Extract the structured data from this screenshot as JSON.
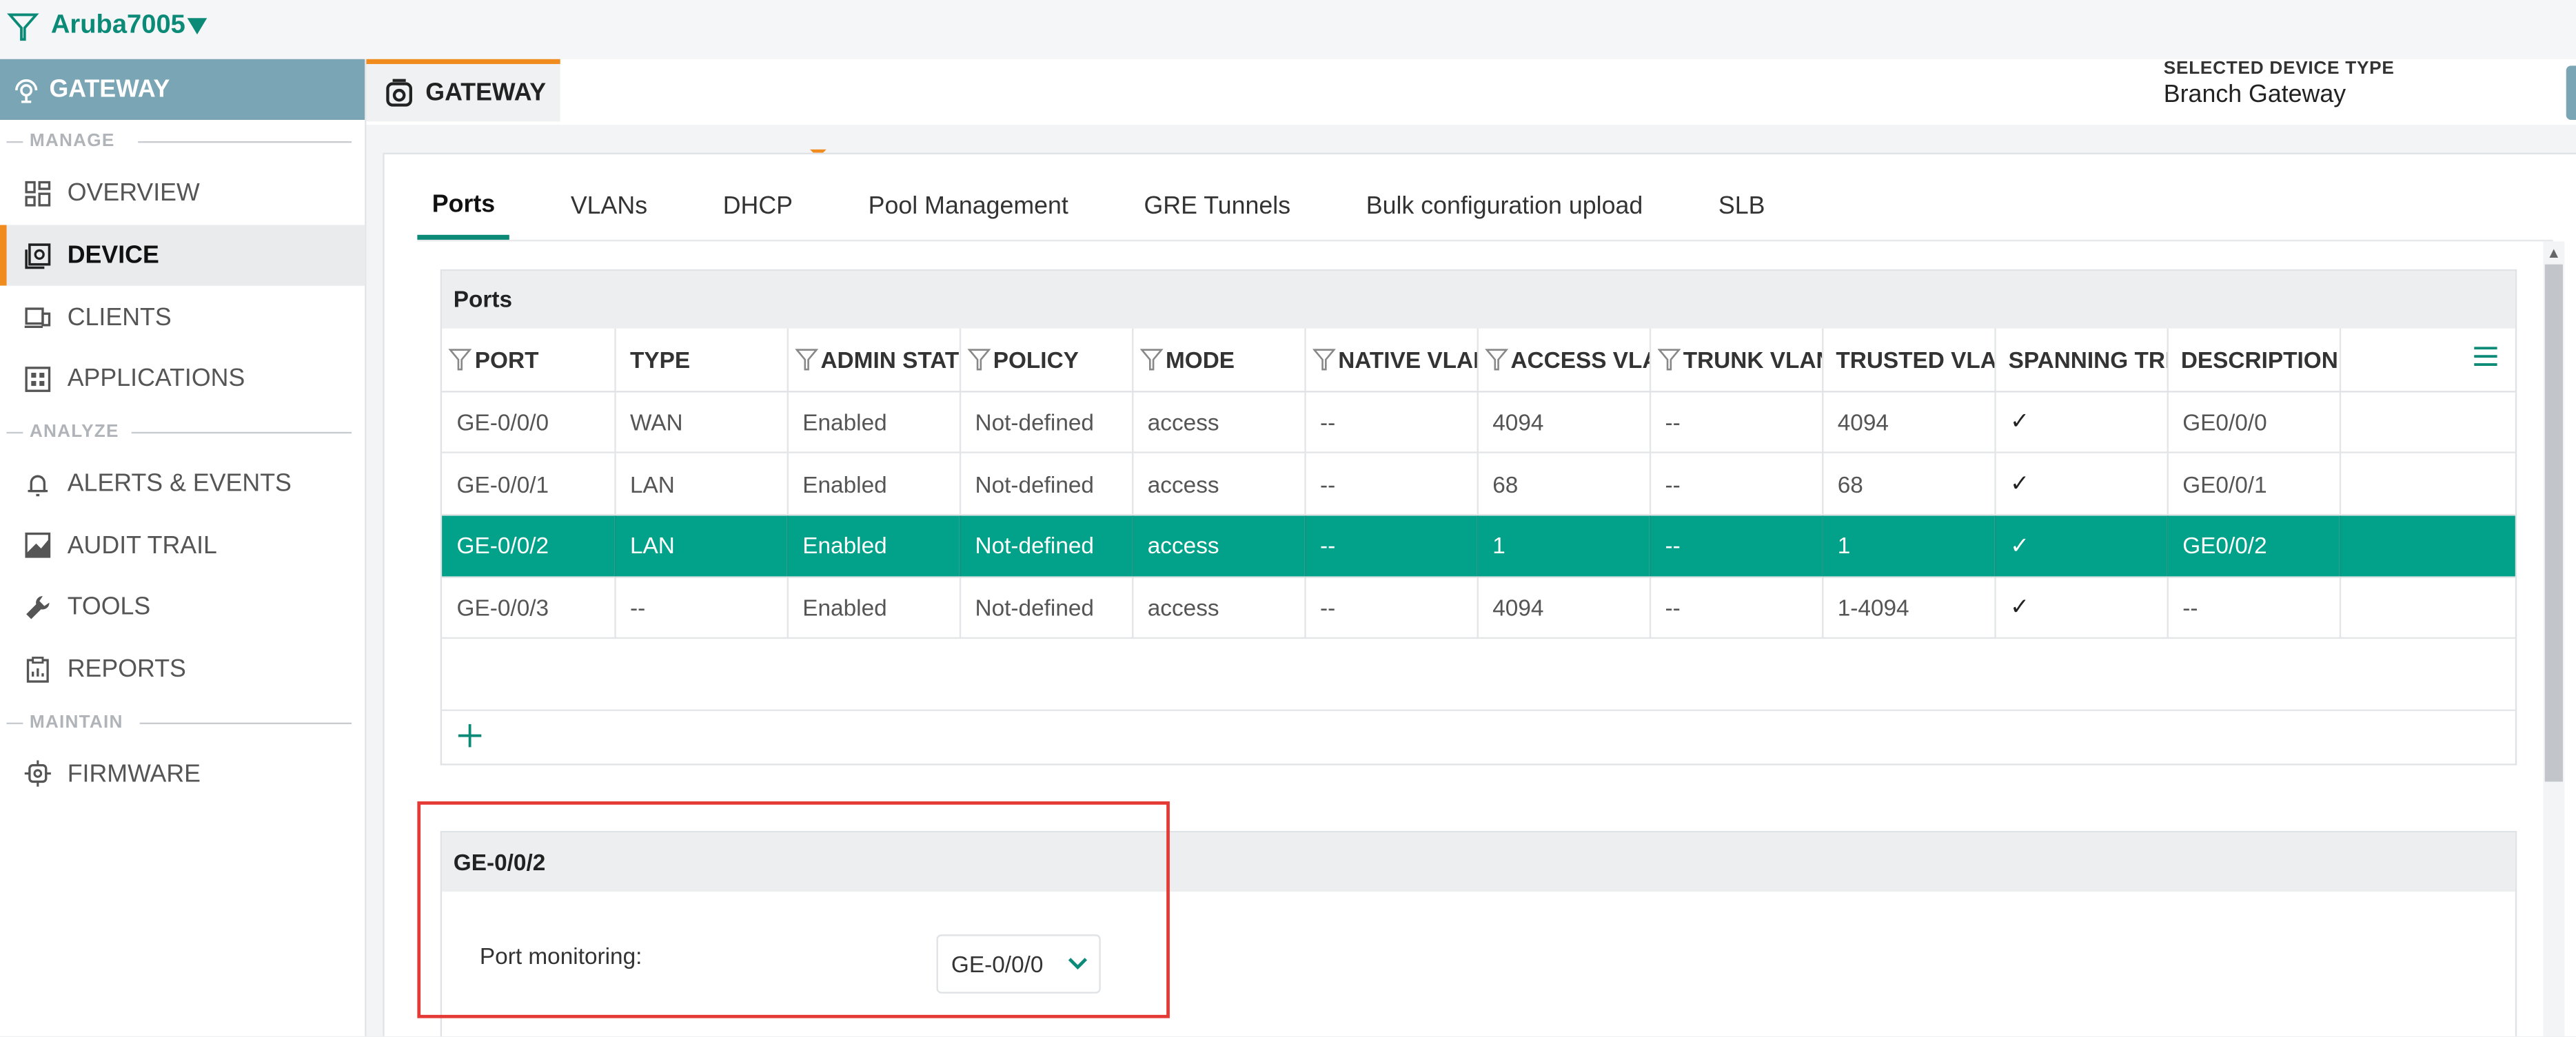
{
  "topbar": {
    "device_name": "Aruba7005"
  },
  "sidebar": {
    "header": "GATEWAY",
    "sections": {
      "manage": "MANAGE",
      "analyze": "ANALYZE",
      "maintain": "MAINTAIN"
    },
    "items": [
      {
        "label": "OVERVIEW",
        "icon": "grid-icon"
      },
      {
        "label": "DEVICE",
        "icon": "device-icon",
        "active": true
      },
      {
        "label": "CLIENTS",
        "icon": "clients-icon"
      },
      {
        "label": "APPLICATIONS",
        "icon": "apps-icon"
      },
      {
        "label": "ALERTS & EVENTS",
        "icon": "bell-icon"
      },
      {
        "label": "AUDIT TRAIL",
        "icon": "audit-icon"
      },
      {
        "label": "TOOLS",
        "icon": "wrench-icon"
      },
      {
        "label": "REPORTS",
        "icon": "reports-icon"
      },
      {
        "label": "FIRMWARE",
        "icon": "firmware-icon"
      }
    ]
  },
  "tabstrip": {
    "gateway_tab": "GATEWAY",
    "selected_device_type_label": "SELECTED DEVICE TYPE",
    "selected_device_type_value": "Branch Gateway"
  },
  "subtabs": [
    "Ports",
    "VLANs",
    "DHCP",
    "Pool Management",
    "GRE Tunnels",
    "Bulk configuration upload",
    "SLB"
  ],
  "ports": {
    "title": "Ports",
    "columns": [
      "PORT",
      "TYPE",
      "ADMIN STATE",
      "POLICY",
      "MODE",
      "NATIVE VLAN",
      "ACCESS VLAN",
      "TRUNK VLAN",
      "TRUSTED VLAN",
      "SPANNING TREE",
      "DESCRIPTION"
    ],
    "rows": [
      [
        "GE-0/0/0",
        "WAN",
        "Enabled",
        "Not-defined",
        "access",
        "--",
        "4094",
        "--",
        "4094",
        "✓",
        "GE0/0/0"
      ],
      [
        "GE-0/0/1",
        "LAN",
        "Enabled",
        "Not-defined",
        "access",
        "--",
        "68",
        "--",
        "68",
        "✓",
        "GE0/0/1"
      ],
      [
        "GE-0/0/2",
        "LAN",
        "Enabled",
        "Not-defined",
        "access",
        "--",
        "1",
        "--",
        "1",
        "✓",
        "GE0/0/2"
      ],
      [
        "GE-0/0/3",
        "--",
        "Enabled",
        "Not-defined",
        "access",
        "--",
        "4094",
        "--",
        "1-4094",
        "✓",
        "--"
      ]
    ],
    "selected_row": 2
  },
  "detail": {
    "title": "GE-0/0/2",
    "port_monitoring_label": "Port monitoring:",
    "port_monitoring_value": "GE-0/0/0"
  },
  "colors": {
    "accent": "#0c8a78",
    "selected_row": "#01a18a",
    "orange": "#f08c1e",
    "sidebar_header": "#7aa5b5",
    "highlight": "#e53935"
  }
}
